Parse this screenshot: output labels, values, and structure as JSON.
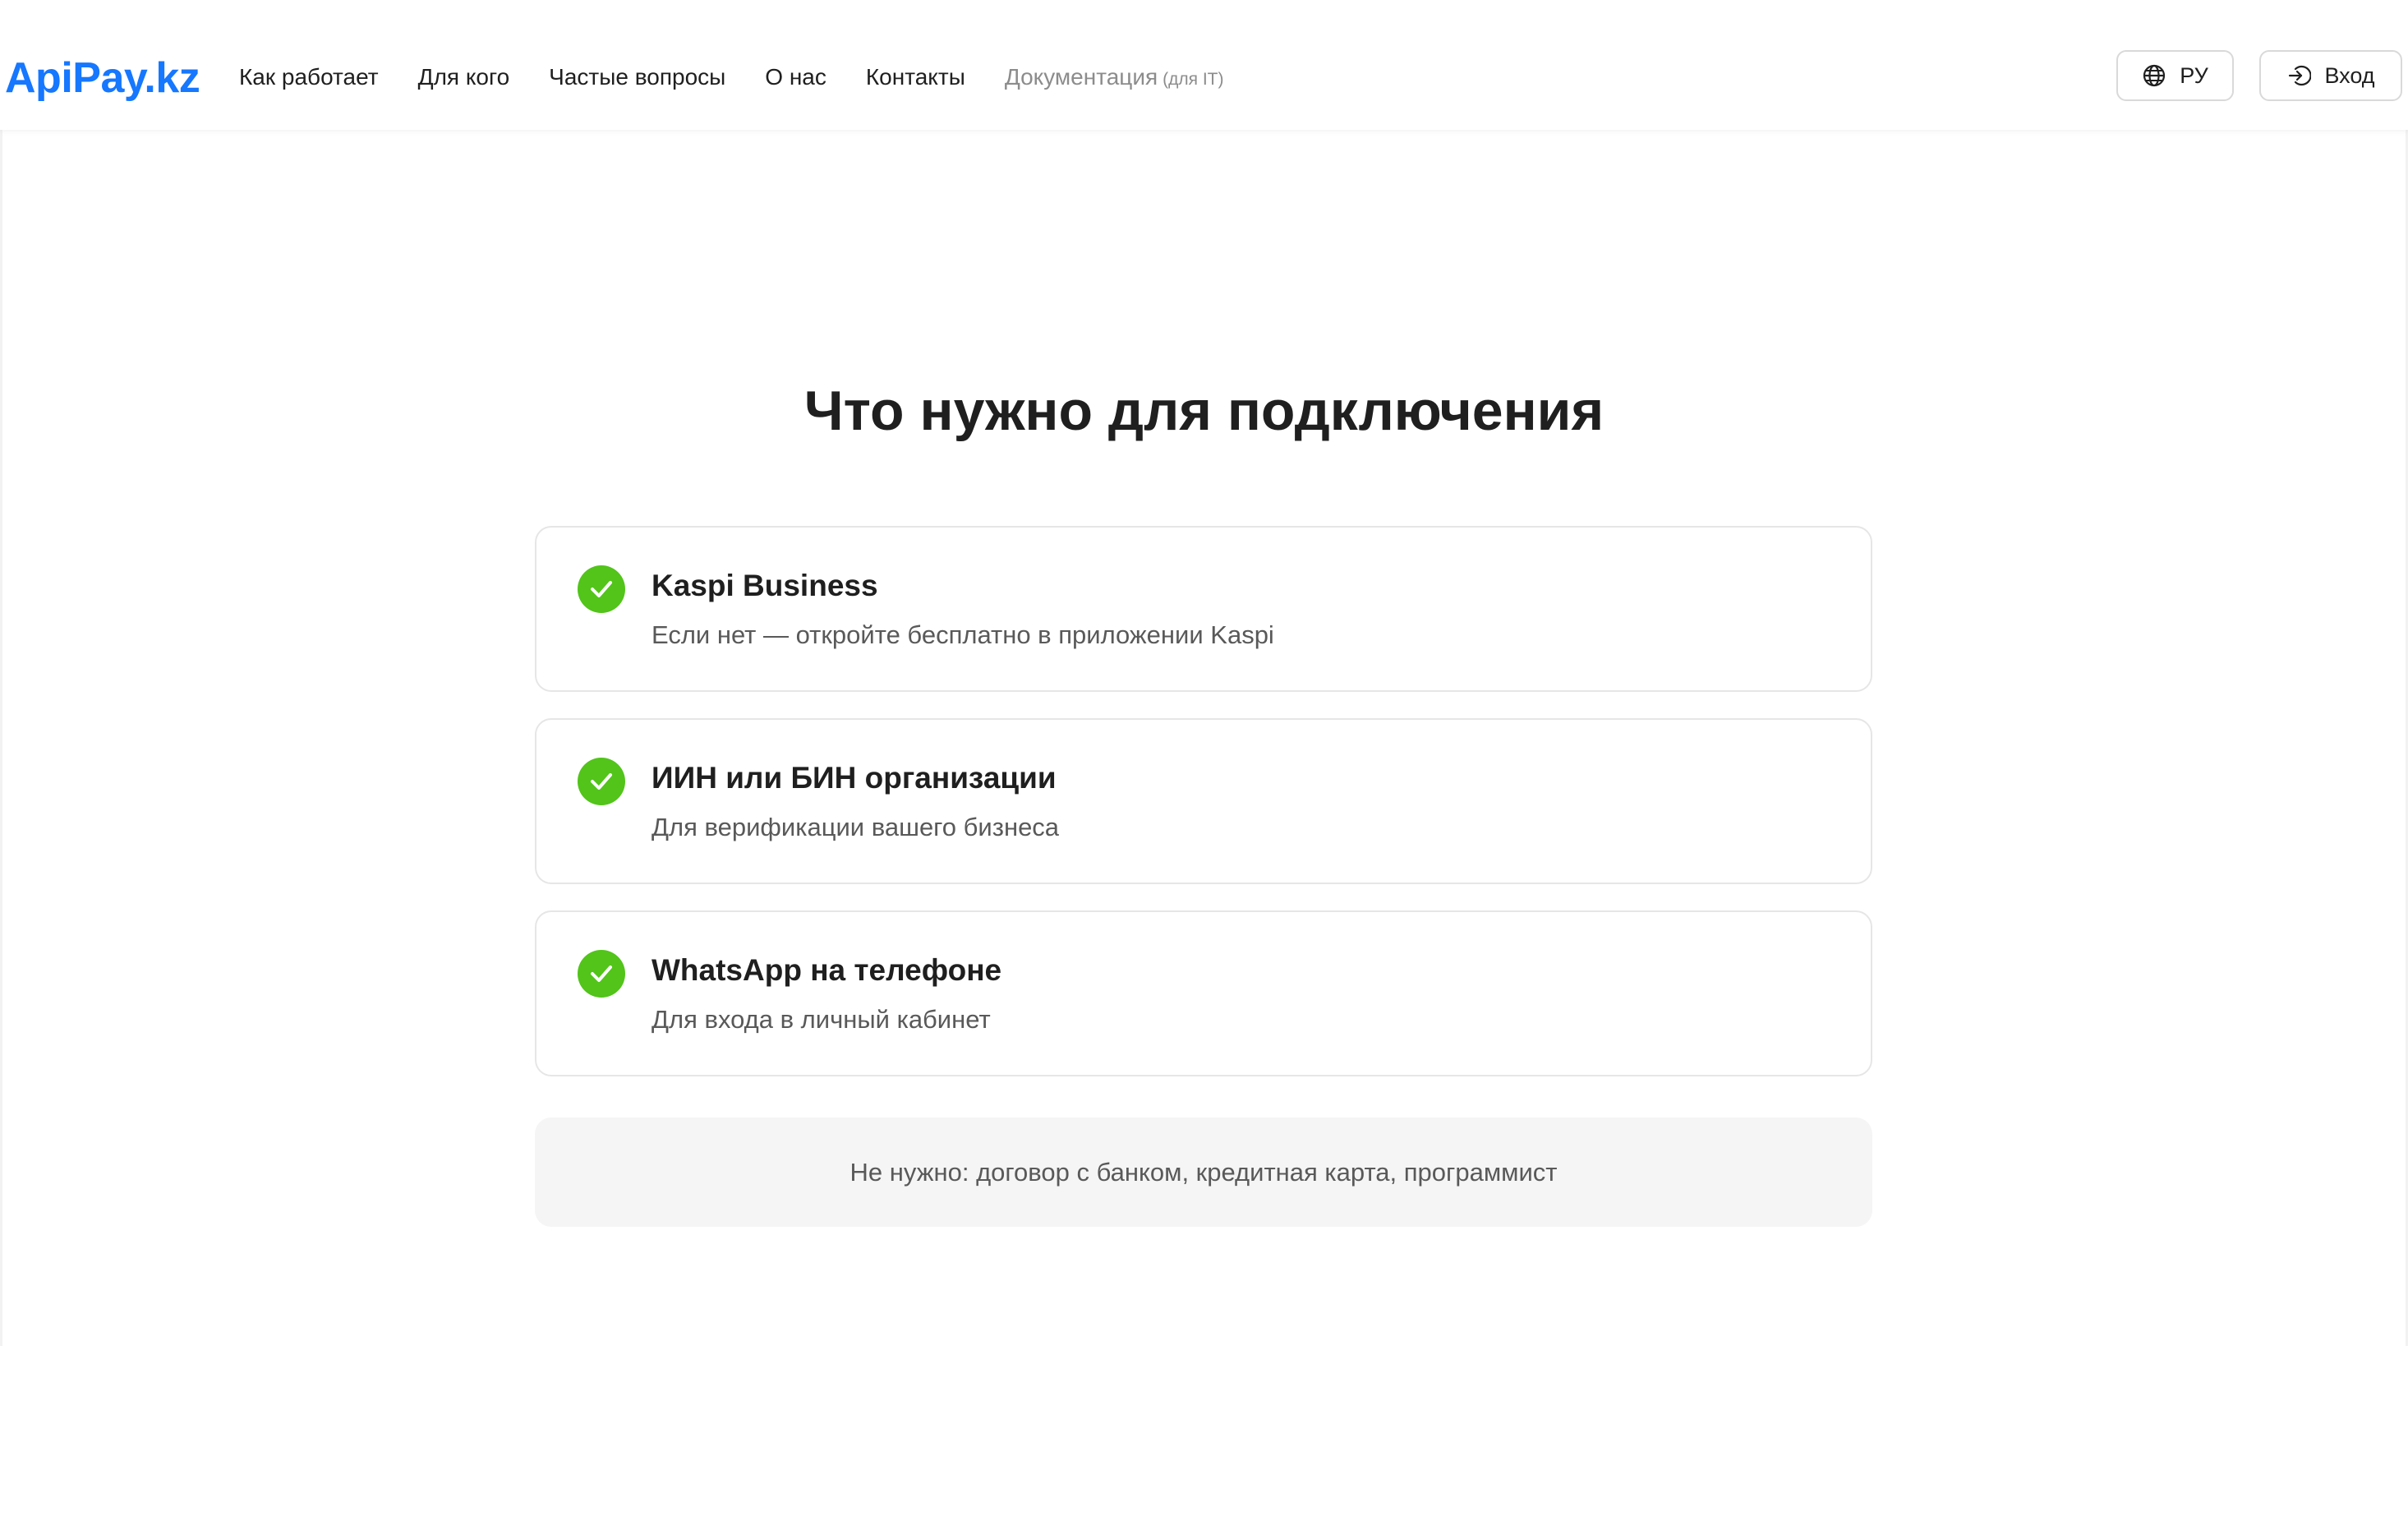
{
  "header": {
    "logo": "ApiPay.kz",
    "nav": [
      {
        "label": "Как работает"
      },
      {
        "label": "Для кого"
      },
      {
        "label": "Частые вопросы"
      },
      {
        "label": "О нас"
      },
      {
        "label": "Контакты"
      },
      {
        "label": "Документация",
        "sub": "(для IT)"
      }
    ],
    "lang_label": "РУ",
    "login_label": "Вход"
  },
  "main": {
    "title": "Что нужно для подключения",
    "items": [
      {
        "title": "Kaspi Business",
        "description": "Если нет — откройте бесплатно в приложении Kaspi"
      },
      {
        "title": "ИИН или БИН организации",
        "description": "Для верификации вашего бизнеса"
      },
      {
        "title": "WhatsApp на телефоне",
        "description": "Для входа в личный кабинет"
      }
    ],
    "note": "Не нужно: договор с банком, кредитная карта, программист"
  },
  "colors": {
    "brand": "#1677ff",
    "check": "#52c41a",
    "note_bg": "#f5f5f5"
  },
  "icons": {
    "lang": "globe-icon",
    "login": "login-icon",
    "check": "check-circle-icon"
  }
}
